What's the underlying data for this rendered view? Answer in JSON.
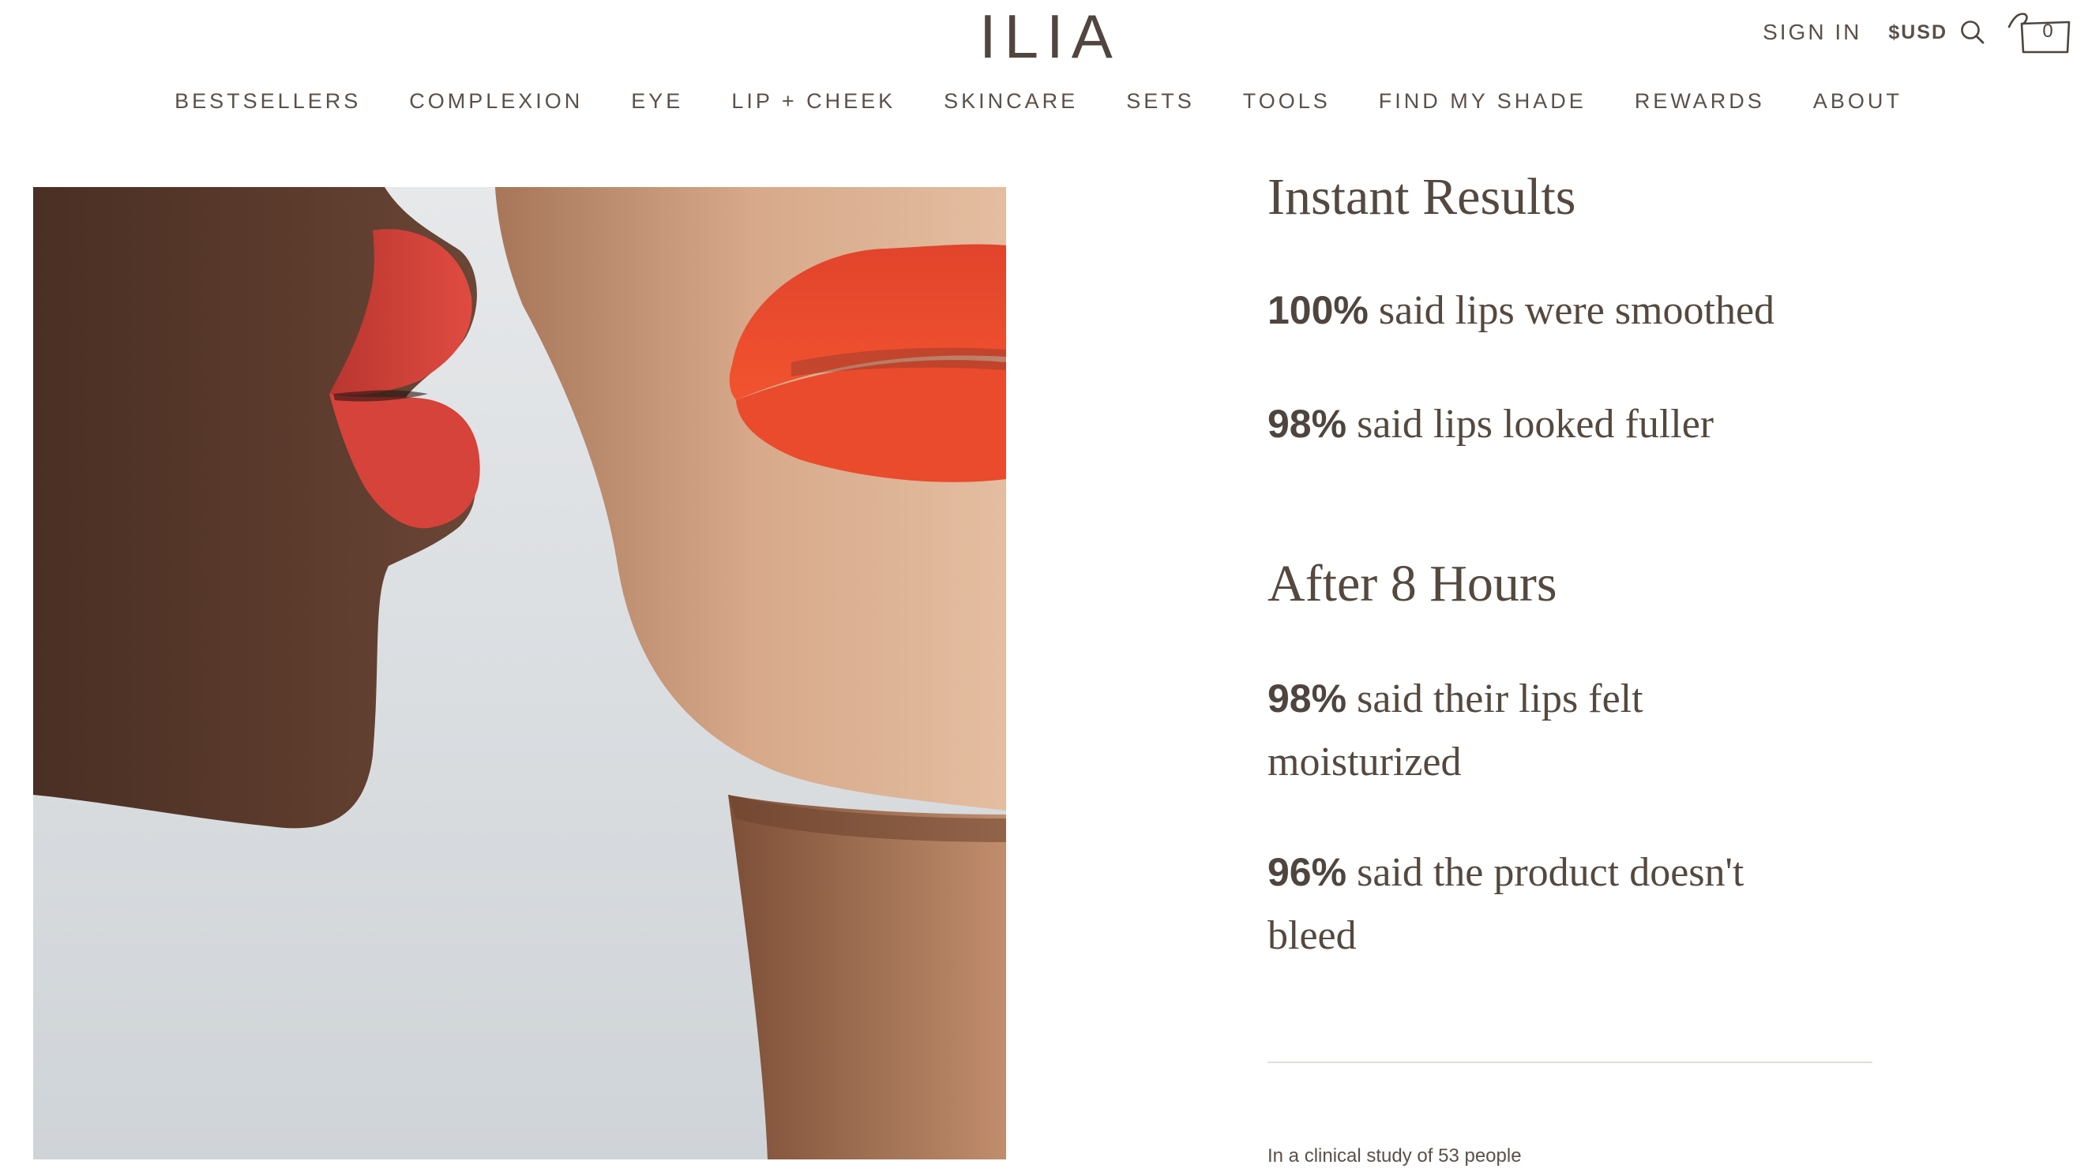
{
  "header": {
    "logo_text": "ILIA",
    "sign_in_label": "SIGN IN",
    "currency_label": "$USD",
    "search_icon": "search-icon",
    "cart_icon": "shopping-bag-icon",
    "cart_count": "0"
  },
  "nav": {
    "items": [
      {
        "label": "BESTSELLERS"
      },
      {
        "label": "COMPLEXION"
      },
      {
        "label": "EYE"
      },
      {
        "label": "LIP + CHEEK"
      },
      {
        "label": "SKINCARE"
      },
      {
        "label": "SETS"
      },
      {
        "label": "TOOLS"
      },
      {
        "label": "FIND MY SHADE"
      },
      {
        "label": "REWARDS"
      },
      {
        "label": "ABOUT"
      }
    ]
  },
  "hero": {
    "image_icon": "lips-photo"
  },
  "results": {
    "instant_heading": "Instant Results",
    "instant_stats": [
      {
        "percent": "100%",
        "text": " said lips were smoothed"
      },
      {
        "percent": "98%",
        "text": " said lips looked fuller"
      }
    ],
    "after_heading": "After 8 Hours",
    "after_stats": [
      {
        "percent": "98%",
        "text": " said their lips felt moisturized"
      },
      {
        "percent": "96%",
        "text": " said the product doesn't bleed"
      }
    ],
    "footnote": "In a clinical study of 53 people"
  },
  "colors": {
    "text": "#4e453f",
    "divider": "#e1dedb",
    "lipstick_left": "#d9423a",
    "lipstick_right": "#ec4a2c",
    "background_photo": "#d6dadd"
  }
}
